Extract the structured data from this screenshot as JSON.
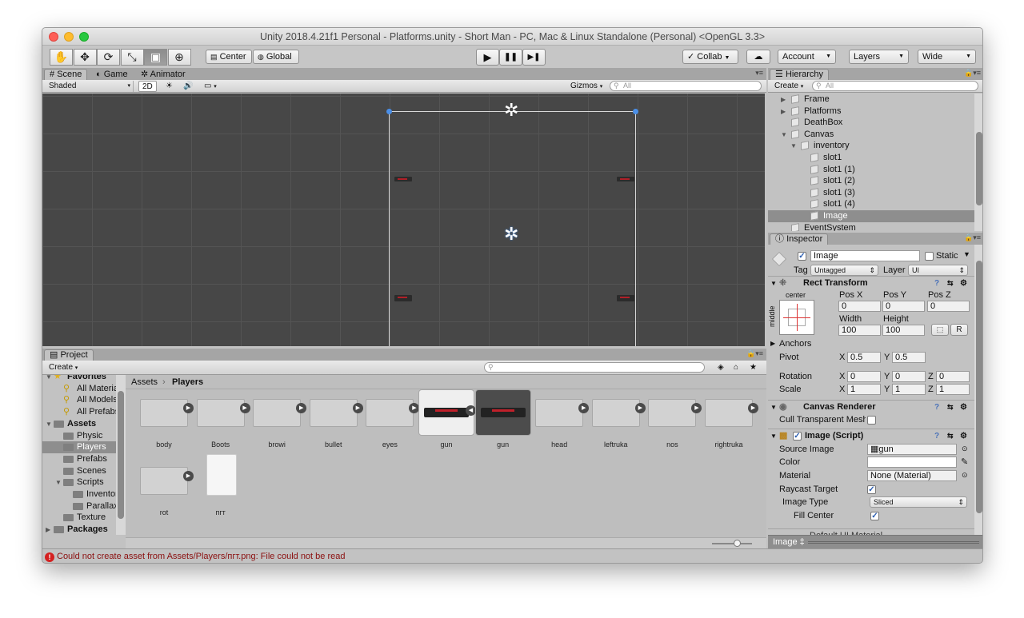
{
  "window": {
    "title": "Unity 2018.4.21f1 Personal - Platforms.unity - Short Man - PC, Mac & Linux Standalone (Personal) <OpenGL 3.3>"
  },
  "toolbar": {
    "tools": [
      "hand-icon",
      "move-icon",
      "rotate-icon",
      "scale-icon",
      "rect-tool-icon",
      "transform-icon"
    ],
    "tool_glyphs": [
      "✋",
      "✥",
      "⟳",
      "⤡",
      "▣",
      "⊕"
    ],
    "pivot": "Center",
    "space": "Global",
    "play": "▶",
    "pause": "❚❚",
    "step": "▶❚",
    "collab": "Collab",
    "account": "Account",
    "layers": "Layers",
    "layout": "Wide"
  },
  "scene_tabs": {
    "scene": "Scene",
    "game": "Game",
    "animator": "Animator"
  },
  "scene_bar": {
    "shading": "Shaded",
    "mode_2d": "2D",
    "gizmos": "Gizmos",
    "search_placeholder": "All"
  },
  "hierarchy": {
    "tab": "Hierarchy",
    "create": "Create",
    "search_placeholder": "All",
    "items": [
      {
        "label": "Frame",
        "indent": 0,
        "arrow": "▶"
      },
      {
        "label": "Platforms",
        "indent": 0,
        "arrow": "▶"
      },
      {
        "label": "DeathBox",
        "indent": 0,
        "arrow": ""
      },
      {
        "label": "Canvas",
        "indent": 0,
        "arrow": "▼"
      },
      {
        "label": "inventory",
        "indent": 1,
        "arrow": "▼"
      },
      {
        "label": "slot1",
        "indent": 2,
        "arrow": ""
      },
      {
        "label": "slot1 (1)",
        "indent": 2,
        "arrow": ""
      },
      {
        "label": "slot1 (2)",
        "indent": 2,
        "arrow": ""
      },
      {
        "label": "slot1 (3)",
        "indent": 2,
        "arrow": ""
      },
      {
        "label": "slot1 (4)",
        "indent": 2,
        "arrow": ""
      },
      {
        "label": "Image",
        "indent": 2,
        "arrow": "",
        "selected": true
      },
      {
        "label": "EventSystem",
        "indent": 0,
        "arrow": ""
      }
    ]
  },
  "inspector": {
    "tab": "Inspector",
    "object_name": "Image",
    "static_label": "Static",
    "tag_label": "Tag",
    "tag_value": "Untagged",
    "layer_label": "Layer",
    "layer_value": "UI",
    "rect_transform": {
      "title": "Rect Transform",
      "anchor_h": "center",
      "anchor_v": "middle",
      "pos_x_label": "Pos X",
      "pos_y_label": "Pos Y",
      "pos_z_label": "Pos Z",
      "pos_x": "0",
      "pos_y": "0",
      "pos_z": "0",
      "width_label": "Width",
      "height_label": "Height",
      "width": "100",
      "height": "100",
      "r_button": "R",
      "anchors": "Anchors",
      "pivot_label": "Pivot",
      "pivot_x": "0.5",
      "pivot_y": "0.5",
      "rotation_label": "Rotation",
      "rot_x": "0",
      "rot_y": "0",
      "rot_z": "0",
      "scale_label": "Scale",
      "scale_x": "1",
      "scale_y": "1",
      "scale_z": "1",
      "x": "X",
      "y": "Y",
      "z": "Z"
    },
    "canvas_renderer": {
      "title": "Canvas Renderer",
      "cull_label": "Cull Transparent Mesh"
    },
    "image_script": {
      "title": "Image (Script)",
      "source_image_label": "Source Image",
      "source_image": "gun",
      "color_label": "Color",
      "material_label": "Material",
      "material": "None (Material)",
      "raycast_label": "Raycast Target",
      "image_type_label": "Image Type",
      "image_type": "Sliced",
      "fill_center_label": "Fill Center"
    },
    "next_component": "Default UI Material",
    "footer": "Image ‡"
  },
  "project": {
    "tab": "Project",
    "create": "Create",
    "breadcrumb": [
      "Assets",
      "Players"
    ],
    "tree": [
      {
        "label": "Favorites",
        "indent": 0,
        "type": "fav-header",
        "arrow": "▼"
      },
      {
        "label": "All Materials",
        "indent": 1,
        "type": "search"
      },
      {
        "label": "All Models",
        "indent": 1,
        "type": "search"
      },
      {
        "label": "All Prefabs",
        "indent": 1,
        "type": "search"
      },
      {
        "label": "Assets",
        "indent": 0,
        "type": "folder-bold",
        "arrow": "▼"
      },
      {
        "label": "Physic",
        "indent": 1,
        "type": "folder"
      },
      {
        "label": "Players",
        "indent": 1,
        "type": "folder",
        "selected": true
      },
      {
        "label": "Prefabs",
        "indent": 1,
        "type": "folder"
      },
      {
        "label": "Scenes",
        "indent": 1,
        "type": "folder"
      },
      {
        "label": "Scripts",
        "indent": 1,
        "type": "folder",
        "arrow": "▼"
      },
      {
        "label": "Inventory",
        "indent": 2,
        "type": "folder"
      },
      {
        "label": "Parallax",
        "indent": 2,
        "type": "folder"
      },
      {
        "label": "Texture",
        "indent": 1,
        "type": "folder"
      },
      {
        "label": "Packages",
        "indent": 0,
        "type": "folder-bold",
        "arrow": "▶"
      }
    ],
    "assets": [
      {
        "name": "body",
        "kind": "sprite"
      },
      {
        "name": "Boots",
        "kind": "sprite"
      },
      {
        "name": "browi",
        "kind": "sprite"
      },
      {
        "name": "bullet",
        "kind": "sprite"
      },
      {
        "name": "eyes",
        "kind": "sprite"
      },
      {
        "name": "gun",
        "kind": "gun"
      },
      {
        "name": "gun",
        "kind": "gun-selected"
      },
      {
        "name": "head",
        "kind": "sprite"
      },
      {
        "name": "leftruka",
        "kind": "sprite"
      },
      {
        "name": "nos",
        "kind": "sprite"
      },
      {
        "name": "rightruka",
        "kind": "sprite"
      },
      {
        "name": "rot",
        "kind": "sprite"
      },
      {
        "name": "пгт",
        "kind": "file"
      }
    ]
  },
  "status": {
    "message": "Could not create asset from Assets/Players/пгт.png: File could not be read"
  },
  "colors": {
    "selection": "#3e7de0",
    "error": "#d42020",
    "scene_bg": "#474747"
  }
}
